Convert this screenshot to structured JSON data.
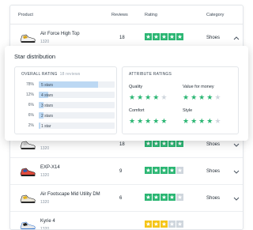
{
  "table": {
    "headers": {
      "product": "Product",
      "reviews": "Reviews",
      "rating": "Rating",
      "category": "Category"
    },
    "rows": [
      {
        "name": "Air Force High Top",
        "price": "1320",
        "reviews": "18",
        "rating": 5,
        "star_color": "#2bb673",
        "category": "Shoes",
        "chevron": "chevron-up-icon"
      },
      {
        "name": "",
        "price": "1320",
        "reviews": "18",
        "rating": 5,
        "star_color": "#2bb673",
        "category": "Shoes",
        "chevron": "chevron-down-icon"
      },
      {
        "name": "EXP-X14",
        "price": "1320",
        "reviews": "9",
        "rating": 4,
        "star_color": "#2bb673",
        "category": "Shoes",
        "chevron": "chevron-down-icon"
      },
      {
        "name": "Air Footscape Mid Utility DM",
        "price": "1320",
        "reviews": "6",
        "rating": 4,
        "star_color": "#2bb673",
        "category": "Shoes",
        "chevron": "chevron-down-icon"
      },
      {
        "name": "Kyrie 4",
        "price": "1320",
        "reviews": "",
        "rating": 3,
        "star_color": "#f5c518",
        "category": "",
        "chevron": ""
      }
    ]
  },
  "panel": {
    "title": "Star distribution",
    "overall": {
      "label": "OVERALL RATING",
      "count_text": "18 reviews",
      "rows": [
        {
          "pct": "78%",
          "label": "5 stars",
          "fraction": 0.78
        },
        {
          "pct": "12%",
          "label": "4 stars",
          "fraction": 0.12
        },
        {
          "pct": "6%",
          "label": "3 stars",
          "fraction": 0.06
        },
        {
          "pct": "6%",
          "label": "2 stars",
          "fraction": 0.06
        },
        {
          "pct": "2%",
          "label": "1 star",
          "fraction": 0.02
        }
      ]
    },
    "attributes": {
      "label": "ATTRIBUTE RATINGS",
      "items": [
        {
          "name": "Quality",
          "rating": 4
        },
        {
          "name": "Value for money",
          "rating": 4
        },
        {
          "name": "Comfort",
          "rating": 5
        },
        {
          "name": "Style",
          "rating": 4
        }
      ]
    }
  },
  "colors": {
    "green": "#2bb673",
    "yellow": "#f5c518",
    "bar_fill": "#bcd8f3",
    "star_empty": "#cfd6dd"
  }
}
